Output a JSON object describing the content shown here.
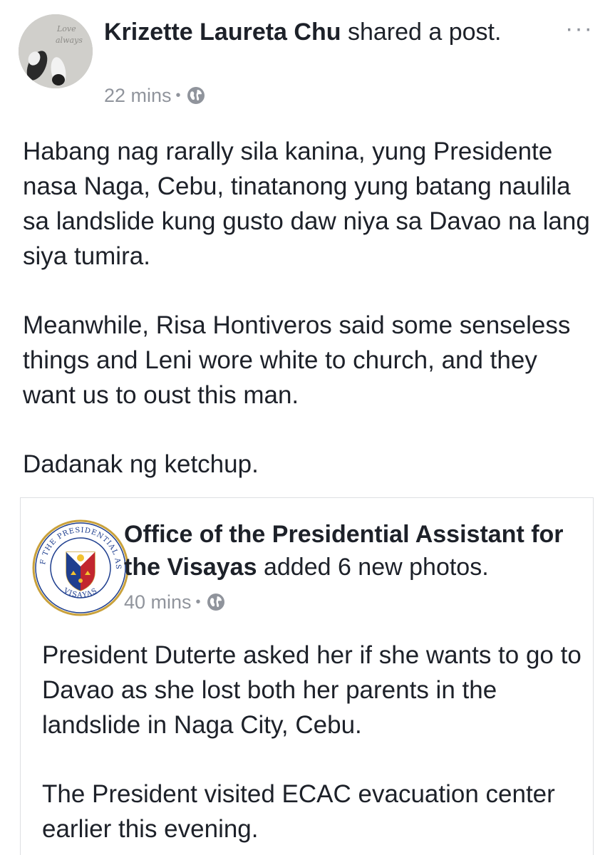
{
  "post": {
    "author": "Krizette Laureta Chu",
    "action": " shared a post.",
    "time": "22 mins",
    "separator": "•",
    "privacy_icon": "globe-icon",
    "more_label": "···",
    "paragraphs": [
      "Habang nag rarally sila kanina, yung Presidente nasa Naga, Cebu, tinatanong yung batang naulila sa landslide kung gusto daw niya sa Davao na lang siya tumira.",
      "Meanwhile, Risa Hontiveros said some senseless things and Leni wore white to church, and they want us to oust this man.",
      "Dadanak ng ketchup."
    ]
  },
  "shared_post": {
    "author": "Office of the Presidential Assistant for the Visayas",
    "action": " added 6 new photos.",
    "time": "40 mins",
    "separator": "•",
    "privacy_icon": "globe-icon",
    "seal_top_text": "OFFICE OF THE PRESIDENTIAL ASSISTANT",
    "seal_bottom_text": "VISAYAS",
    "paragraphs": [
      "President Duterte asked her if she wants to go to Davao as she lost both her parents in the landslide in Naga City, Cebu.",
      "The President visited ECAC evacuation center earlier this evening."
    ]
  },
  "colors": {
    "text": "#1d2129",
    "meta": "#90949c",
    "border": "#dddfe2",
    "seal_gold": "#c9a13b",
    "seal_blue": "#1f3f8f",
    "seal_red": "#c2262e"
  }
}
